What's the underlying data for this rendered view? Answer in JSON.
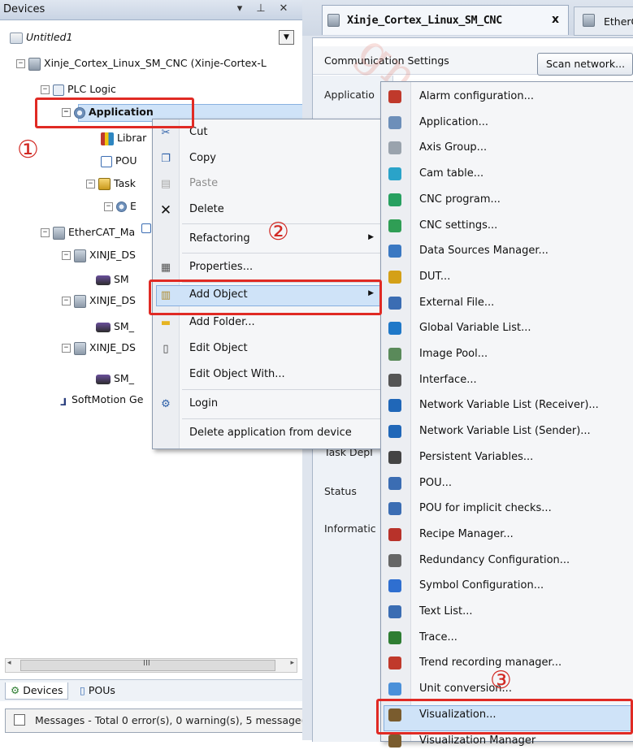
{
  "devices_panel": {
    "title": "Devices",
    "titlebar_icons": [
      "pin-dropdown-icon",
      "pin-icon",
      "close-icon"
    ],
    "tree": [
      {
        "label": "Untitled1",
        "icon": "project-icon"
      },
      {
        "label": "Xinje_Cortex_Linux_SM_CNC (Xinje-Cortex-L",
        "icon": "device-icon",
        "expander": "minus"
      },
      {
        "label": "PLC Logic",
        "icon": "plc-logic-icon",
        "expander": "minus"
      },
      {
        "label": "Application",
        "icon": "application-gear-icon",
        "expander": "minus",
        "selected": true
      },
      {
        "label": "Librar",
        "icon": "library-icon"
      },
      {
        "label": "POU",
        "icon": "pou-icon"
      },
      {
        "label": "Task",
        "icon": "task-config-icon",
        "expander": "minus"
      },
      {
        "label": "E",
        "icon": "task-icon",
        "expander": "minus"
      },
      {
        "label": "",
        "icon": "program-call-icon"
      },
      {
        "label": "EtherCAT_Ma",
        "icon": "device-icon",
        "expander": "minus"
      },
      {
        "label": "XINJE_DS",
        "icon": "device-icon",
        "expander": "minus"
      },
      {
        "label": "SM",
        "icon": "axis-icon"
      },
      {
        "label": "XINJE_DS",
        "icon": "device-icon",
        "expander": "minus"
      },
      {
        "label": "SM_",
        "icon": "axis-icon"
      },
      {
        "label": "XINJE_DS",
        "icon": "device-icon",
        "expander": "minus"
      },
      {
        "label": "SM_",
        "icon": "axis-icon"
      },
      {
        "label": "SoftMotion Ge",
        "icon": "softmotion-icon"
      }
    ],
    "scrollbar_grip": "III",
    "bottom_tabs": [
      "Devices",
      "POUs"
    ]
  },
  "messages_bar": {
    "text": "Messages - Total 0 error(s), 0 warning(s), 5 message(s)"
  },
  "editor": {
    "active_tab": "Xinje_Cortex_Linux_SM_CNC",
    "inactive_tab": "EtherC",
    "comm_settings_label": "Communication Settings",
    "scan_network_button": "Scan network...",
    "side_nav": [
      "Applicatio",
      "Task Depl",
      "Status",
      "Informatic"
    ]
  },
  "context_menu": {
    "items": [
      {
        "label": "Cut",
        "icon": "cut-icon",
        "enabled": true
      },
      {
        "label": "Copy",
        "icon": "copy-icon",
        "enabled": true
      },
      {
        "label": "Paste",
        "icon": "paste-icon",
        "enabled": false
      },
      {
        "label": "Delete",
        "icon": "delete-icon",
        "enabled": true
      },
      {
        "label": "Refactoring",
        "icon": "",
        "enabled": true,
        "submenu": true
      },
      {
        "label": "Properties...",
        "icon": "properties-icon",
        "enabled": true
      },
      {
        "label": "Add Object",
        "icon": "add-object-icon",
        "enabled": true,
        "submenu": true,
        "highlighted": true
      },
      {
        "label": "Add Folder...",
        "icon": "folder-icon",
        "enabled": true
      },
      {
        "label": "Edit Object",
        "icon": "edit-object-icon",
        "enabled": true
      },
      {
        "label": "Edit Object With...",
        "icon": "",
        "enabled": true
      },
      {
        "label": "Login",
        "icon": "login-icon",
        "enabled": true
      },
      {
        "label": "Delete application from device",
        "icon": "",
        "enabled": true
      }
    ]
  },
  "submenu": {
    "items": [
      {
        "label": "Alarm configuration...",
        "icon": "alarm-config-icon",
        "color": "#c0392b"
      },
      {
        "label": "Application...",
        "icon": "application-icon",
        "color": "#6d8fb9"
      },
      {
        "label": "Axis Group...",
        "icon": "axis-group-icon",
        "color": "#9aa3ad"
      },
      {
        "label": "Cam table...",
        "icon": "cam-table-icon",
        "color": "#2aa3c9"
      },
      {
        "label": "CNC program...",
        "icon": "cnc-program-icon",
        "color": "#27a060"
      },
      {
        "label": "CNC settings...",
        "icon": "cnc-settings-icon",
        "color": "#2f9e55"
      },
      {
        "label": "Data Sources Manager...",
        "icon": "data-sources-icon",
        "color": "#3a78c2"
      },
      {
        "label": "DUT...",
        "icon": "dut-icon",
        "color": "#d4a017"
      },
      {
        "label": "External File...",
        "icon": "external-file-icon",
        "color": "#3b6db3"
      },
      {
        "label": "Global Variable List...",
        "icon": "global-variable-list-icon",
        "color": "#1f78c8"
      },
      {
        "label": "Image Pool...",
        "icon": "image-pool-icon",
        "color": "#5a8a5a"
      },
      {
        "label": "Interface...",
        "icon": "interface-icon",
        "color": "#555555"
      },
      {
        "label": "Network Variable List (Receiver)...",
        "icon": "nvl-receiver-icon",
        "color": "#2067b8"
      },
      {
        "label": "Network Variable List (Sender)...",
        "icon": "nvl-sender-icon",
        "color": "#2067b8"
      },
      {
        "label": "Persistent Variables...",
        "icon": "persistent-variables-icon",
        "color": "#444444"
      },
      {
        "label": "POU...",
        "icon": "pou-icon",
        "color": "#3b6db3"
      },
      {
        "label": "POU for implicit checks...",
        "icon": "pou-implicit-checks-icon",
        "color": "#3b6db3"
      },
      {
        "label": "Recipe Manager...",
        "icon": "recipe-manager-icon",
        "color": "#b8322a"
      },
      {
        "label": "Redundancy Configuration...",
        "icon": "redundancy-icon",
        "color": "#666666"
      },
      {
        "label": "Symbol Configuration...",
        "icon": "symbol-config-icon",
        "color": "#2f6fd0"
      },
      {
        "label": "Text List...",
        "icon": "text-list-icon",
        "color": "#3b6db3"
      },
      {
        "label": "Trace...",
        "icon": "trace-icon",
        "color": "#2e7d32"
      },
      {
        "label": "Trend recording manager...",
        "icon": "trend-recording-icon",
        "color": "#c0392b"
      },
      {
        "label": "Unit conversion...",
        "icon": "unit-conversion-icon",
        "color": "#4a90d9"
      },
      {
        "label": "Visualization...",
        "icon": "visualization-icon",
        "color": "#7a5c2e",
        "highlighted": true
      },
      {
        "label": "Visualization Manager",
        "icon": "visualization-manager-icon",
        "color": "#7a5c2e"
      }
    ]
  },
  "annotations": {
    "step1": "①",
    "step2": "②",
    "step3": "③",
    "accent": "#e02a24"
  },
  "watermark": "gnoatoa"
}
